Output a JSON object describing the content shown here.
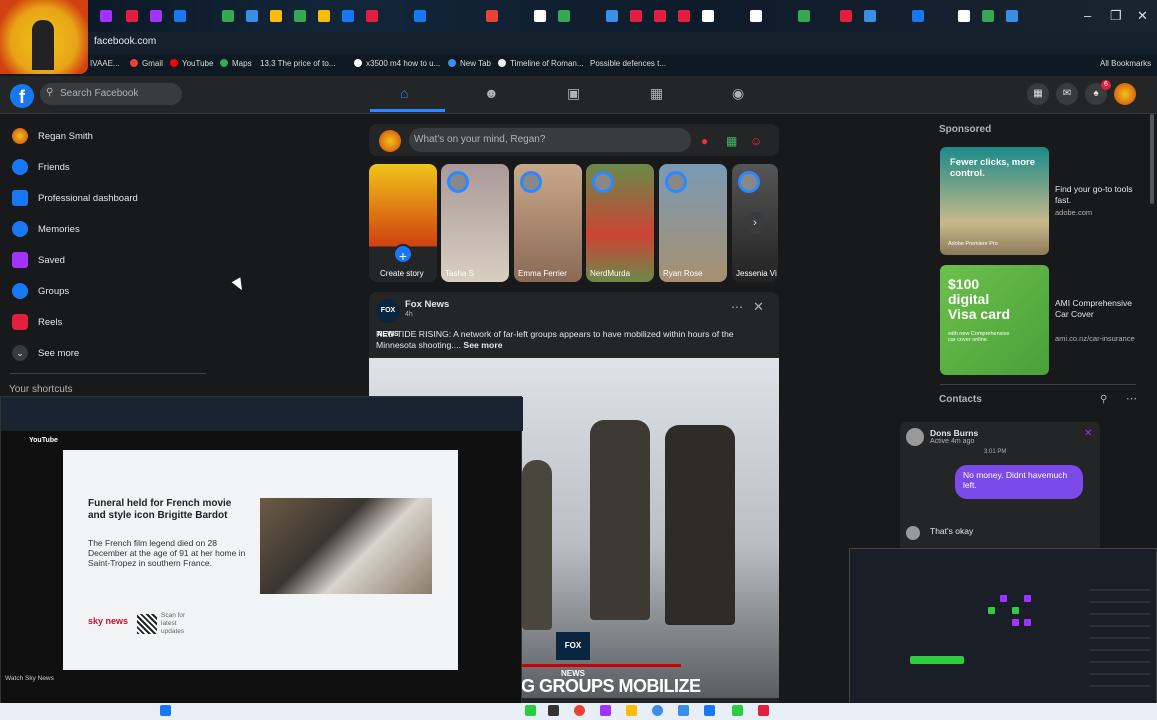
{
  "browser": {
    "url": "facebook.com",
    "bookmarks": [
      "IVAAE...",
      "Gmail",
      "YouTube",
      "Maps",
      "13.3 The price of to...",
      "x3500 m4 how to u...",
      "New Tab",
      "Timeline of Roman...",
      "Possible defences t..."
    ],
    "all_bookmarks": "All Bookmarks",
    "window_controls": [
      "–",
      "❐",
      "✕"
    ]
  },
  "header": {
    "logo": "f",
    "search_placeholder": "Search Facebook",
    "notification_count": "6"
  },
  "sidebar": {
    "items": [
      {
        "label": "Regan Smith",
        "icon": "avatar-icon",
        "color": "#e8a317"
      },
      {
        "label": "Friends",
        "icon": "friends-icon",
        "color": "#1877f2"
      },
      {
        "label": "Professional dashboard",
        "icon": "dashboard-icon",
        "color": "#1877f2"
      },
      {
        "label": "Memories",
        "icon": "memories-icon",
        "color": "#1877f2"
      },
      {
        "label": "Saved",
        "icon": "saved-icon",
        "color": "#a033ff"
      },
      {
        "label": "Groups",
        "icon": "groups-icon",
        "color": "#1877f2"
      },
      {
        "label": "Reels",
        "icon": "reels-icon",
        "color": "#e41e3f"
      },
      {
        "label": "See more",
        "icon": "chevron-down-icon",
        "color": "#3a3b3c"
      }
    ],
    "shortcuts_title": "Your shortcuts"
  },
  "composer": {
    "placeholder": "What's on your mind, Regan?"
  },
  "stories": [
    {
      "name": "Create story",
      "color": "#e8a317"
    },
    {
      "name": "Tasha S",
      "color": "#d8cfc0"
    },
    {
      "name": "Emma Ferrier",
      "color": "#c9a88a"
    },
    {
      "name": "NerdMurda",
      "color": "#6a8a4a"
    },
    {
      "name": "Ryan Rose",
      "color": "#7a9ab5"
    },
    {
      "name": "Jessenia Vi",
      "color": "#444"
    }
  ],
  "post": {
    "author": "Fox News",
    "time": "4h",
    "text": "RED TIDE RISING: A network of far-left groups appears to have mobilized within hours of the Minnesota shooting....",
    "see_more": "See more",
    "logo_text": "FOX NEWS",
    "image_caption": "G GROUPS MOBILIZE",
    "image_logo": "FOX NEWS"
  },
  "right": {
    "sponsored_title": "Sponsored",
    "ads": [
      {
        "title": "Find your go-to tools fast.",
        "url": "adobe.com",
        "img_text": "Fewer clicks, more control.",
        "sub": "Adobe Premiere Pro"
      },
      {
        "title": "AMI Comprehensive Car Cover",
        "url": "ami.co.nz/car-insurance",
        "img_text": "$100 digital Visa card",
        "sub": "with new Comprehensive car cover online."
      }
    ],
    "contacts_title": "Contacts"
  },
  "chat": {
    "name": "Dons Burns",
    "status": "Active 4m ago",
    "time": "3:01 PM",
    "message": "No money. Didnt havemuch left.",
    "reply": "That's okay"
  },
  "pip_youtube": {
    "headline": "Funeral held for French movie and style icon Brigitte Bardot",
    "body": "The French film legend died on 28 December at the age of 91 at her home in Saint-Tropez in southern France.",
    "brand": "sky news",
    "scan": "Scan for latest updates",
    "footer": "Watch Sky News",
    "site": "YouTube"
  }
}
